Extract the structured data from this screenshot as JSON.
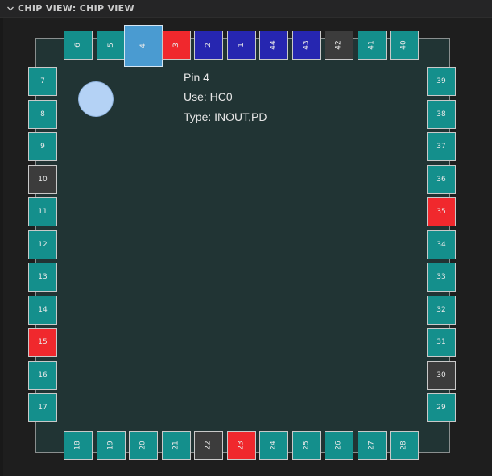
{
  "panel": {
    "title": "CHIP VIEW: CHIP VIEW"
  },
  "info": {
    "pin": "Pin 4",
    "use": "Use: HC0",
    "type": "Type: INOUT,PD"
  },
  "colors": {
    "teal": "#148f8c",
    "gray": "#3c3c3c",
    "red": "#f0282d",
    "blue": "#2626b0",
    "selected": "#4a9bd1"
  },
  "pins": {
    "top": [
      {
        "label": "6",
        "color": "teal"
      },
      {
        "label": "5",
        "color": "teal"
      },
      {
        "label": "4",
        "color": "selected"
      },
      {
        "label": "3",
        "color": "red"
      },
      {
        "label": "2",
        "color": "blue"
      },
      {
        "label": "1",
        "color": "blue"
      },
      {
        "label": "44",
        "color": "blue"
      },
      {
        "label": "43",
        "color": "blue"
      },
      {
        "label": "42",
        "color": "gray"
      },
      {
        "label": "41",
        "color": "teal"
      },
      {
        "label": "40",
        "color": "teal"
      }
    ],
    "left": [
      {
        "label": "7",
        "color": "teal"
      },
      {
        "label": "8",
        "color": "teal"
      },
      {
        "label": "9",
        "color": "teal"
      },
      {
        "label": "10",
        "color": "gray"
      },
      {
        "label": "11",
        "color": "teal"
      },
      {
        "label": "12",
        "color": "teal"
      },
      {
        "label": "13",
        "color": "teal"
      },
      {
        "label": "14",
        "color": "teal"
      },
      {
        "label": "15",
        "color": "red"
      },
      {
        "label": "16",
        "color": "teal"
      },
      {
        "label": "17",
        "color": "teal"
      }
    ],
    "right": [
      {
        "label": "39",
        "color": "teal"
      },
      {
        "label": "38",
        "color": "teal"
      },
      {
        "label": "37",
        "color": "teal"
      },
      {
        "label": "36",
        "color": "teal"
      },
      {
        "label": "35",
        "color": "red"
      },
      {
        "label": "34",
        "color": "teal"
      },
      {
        "label": "33",
        "color": "teal"
      },
      {
        "label": "32",
        "color": "teal"
      },
      {
        "label": "31",
        "color": "teal"
      },
      {
        "label": "30",
        "color": "gray"
      },
      {
        "label": "29",
        "color": "teal"
      }
    ],
    "bottom": [
      {
        "label": "18",
        "color": "teal"
      },
      {
        "label": "19",
        "color": "teal"
      },
      {
        "label": "20",
        "color": "teal"
      },
      {
        "label": "21",
        "color": "teal"
      },
      {
        "label": "22",
        "color": "gray"
      },
      {
        "label": "23",
        "color": "red"
      },
      {
        "label": "24",
        "color": "teal"
      },
      {
        "label": "25",
        "color": "teal"
      },
      {
        "label": "26",
        "color": "teal"
      },
      {
        "label": "27",
        "color": "teal"
      },
      {
        "label": "28",
        "color": "teal"
      }
    ]
  }
}
